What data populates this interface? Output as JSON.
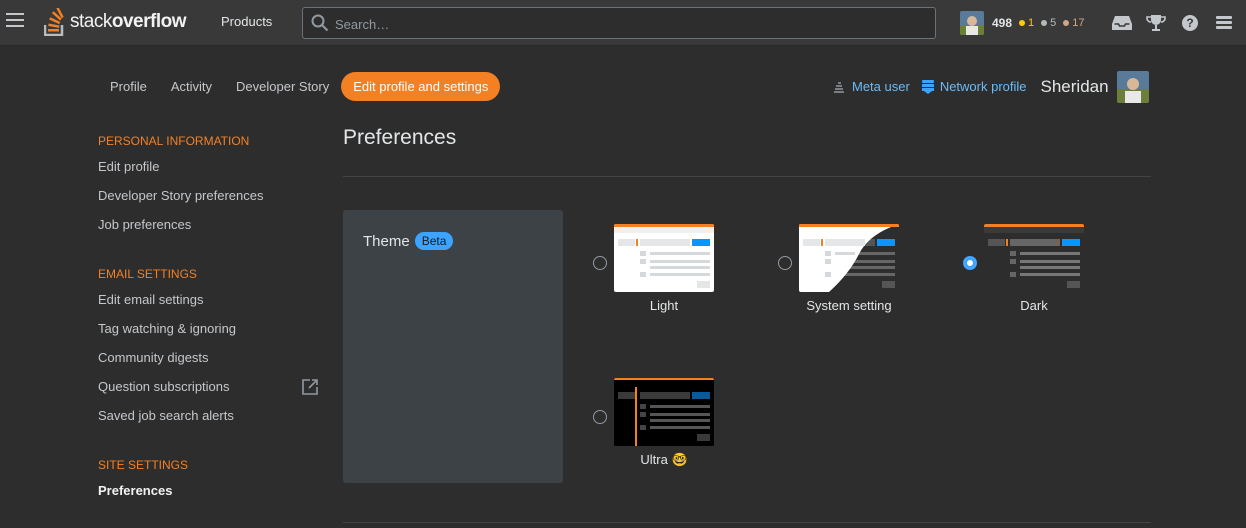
{
  "header": {
    "logo_text_light": "stack",
    "logo_text_bold": "overflow",
    "products_label": "Products",
    "search_placeholder": "Search…",
    "reputation": "498",
    "gold": "1",
    "silver": "5",
    "bronze": "17",
    "badge_colors": {
      "gold": "#ffcc01",
      "silver": "#b4b8bc",
      "bronze": "#d1a684"
    }
  },
  "tabs": [
    {
      "label": "Profile"
    },
    {
      "label": "Activity"
    },
    {
      "label": "Developer Story"
    },
    {
      "label": "Edit profile and settings",
      "active": true
    }
  ],
  "profile_links": {
    "meta_user": "Meta user",
    "network_profile": "Network profile",
    "user_name": "Sheridan"
  },
  "sidebar": {
    "personal_title": "Personal Information",
    "personal_items": [
      "Edit profile",
      "Developer Story preferences",
      "Job preferences"
    ],
    "email_title": "Email Settings",
    "email_items": [
      "Edit email settings",
      "Tag watching & ignoring",
      "Community digests",
      "Question subscriptions",
      "Saved job search alerts"
    ],
    "site_title": "Site Settings",
    "site_items": [
      "Preferences"
    ]
  },
  "main": {
    "title": "Preferences",
    "theme_label": "Theme",
    "beta_badge": "Beta",
    "options": [
      {
        "label": "Light",
        "selected": false
      },
      {
        "label": "System setting",
        "selected": false
      },
      {
        "label": "Dark",
        "selected": true
      },
      {
        "label": "Ultra",
        "selected": false,
        "emoji": "🤓"
      }
    ]
  },
  "colors": {
    "accent": "#f48024",
    "link": "#6bbbf7",
    "selected_radio": "#3ca4ff"
  }
}
